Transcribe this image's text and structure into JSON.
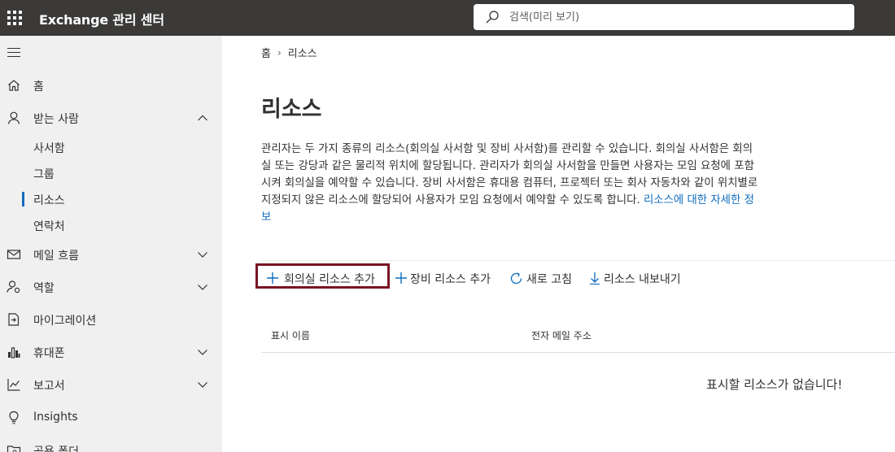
{
  "topbar": {
    "app_title": "Exchange 관리 센터",
    "search_placeholder": "검색(미리 보기)"
  },
  "sidebar": {
    "items": [
      {
        "label": "홈",
        "icon": "home-icon"
      },
      {
        "label": "받는 사람",
        "icon": "person-icon",
        "expanded": true
      },
      {
        "label": "메일 흐름",
        "icon": "mail-icon"
      },
      {
        "label": "역할",
        "icon": "roles-icon"
      },
      {
        "label": "마이그레이션",
        "icon": "migration-icon"
      },
      {
        "label": "휴대폰",
        "icon": "mobile-icon"
      },
      {
        "label": "보고서",
        "icon": "reports-icon"
      },
      {
        "label": "Insights",
        "icon": "lightbulb-icon"
      },
      {
        "label": "공용 폴더",
        "icon": "folder-icon"
      }
    ],
    "subitems": [
      {
        "label": "사서함"
      },
      {
        "label": "그룹"
      },
      {
        "label": "리소스",
        "active": true
      },
      {
        "label": "연락처"
      }
    ]
  },
  "breadcrumb": {
    "home": "홈",
    "current": "리소스"
  },
  "page": {
    "title": "리소스",
    "description": "관리자는 두 가지 종류의 리소스(회의실 사서함 및 장비 사서함)를 관리할 수 있습니다. 회의실 사서함은 회의실 또는 강당과 같은 물리적 위치에 할당됩니다. 관리자가 회의실 사서함을 만들면 사용자는 모임 요청에 포함시켜 회의실을 예약할 수 있습니다. 장비 사서함은 휴대용 컴퓨터, 프로젝터 또는 회사 자동차와 같이 위치별로 지정되지 않은 리소스에 할당되어 사용자가 모임 요청에서 예약할 수 있도록 합니다. ",
    "learn_more": "리소스에 대한 자세한 정보"
  },
  "toolbar": {
    "add_room": "회의실 리소스 추가",
    "add_equipment": "장비 리소스 추가",
    "refresh": "새로 고침",
    "export": "리소스 내보내기"
  },
  "table": {
    "columns": [
      "표시 이름",
      "전자 메일 주소"
    ],
    "empty_message": "표시할 리소스가 없습니다!"
  },
  "colors": {
    "topbar": "#3b3a39",
    "sidebar": "#f0f0f0",
    "accent": "#0f6cbd",
    "highlight": "#7a1322"
  }
}
